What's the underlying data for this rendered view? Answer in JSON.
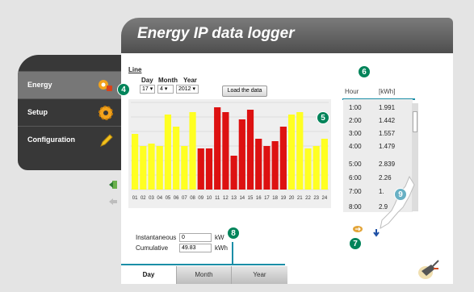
{
  "header": {
    "title": "Energy IP data logger"
  },
  "sidebar": {
    "items": [
      {
        "label": "Energy",
        "icon": "energy-icon"
      },
      {
        "label": "Setup",
        "icon": "gear-icon"
      },
      {
        "label": "Configuration",
        "icon": "pencil-icon"
      }
    ]
  },
  "controls": {
    "link": "Line",
    "day_label": "Day",
    "month_label": "Month",
    "year_label": "Year",
    "day_value": "17",
    "month_value": "4",
    "year_value": "2012",
    "load_button": "Load the data"
  },
  "chart_data": {
    "type": "bar",
    "categories": [
      "01",
      "02",
      "03",
      "04",
      "05",
      "06",
      "07",
      "08",
      "09",
      "10",
      "11",
      "12",
      "13",
      "14",
      "15",
      "16",
      "17",
      "18",
      "19",
      "20",
      "21",
      "22",
      "23",
      "24"
    ],
    "values": [
      2.3,
      1.8,
      1.9,
      1.8,
      3.1,
      2.6,
      1.8,
      3.2,
      1.7,
      1.7,
      3.4,
      3.2,
      1.4,
      2.9,
      3.3,
      2.1,
      1.8,
      2.0,
      2.6,
      3.1,
      3.2,
      1.7,
      1.8,
      2.1
    ],
    "colors": [
      "#ffff22",
      "#ffff22",
      "#ffff22",
      "#ffff22",
      "#ffff22",
      "#ffff22",
      "#ffff22",
      "#ffff22",
      "#dd1111",
      "#dd1111",
      "#dd1111",
      "#dd1111",
      "#dd1111",
      "#dd1111",
      "#dd1111",
      "#dd1111",
      "#dd1111",
      "#dd1111",
      "#dd1111",
      "#ffff22",
      "#ffff22",
      "#ffff22",
      "#ffff22",
      "#ffff22"
    ],
    "ylim": [
      0,
      3.6
    ],
    "grid": true
  },
  "table": {
    "hour_header": "Hour",
    "unit_header": "[kWh]",
    "rows": [
      {
        "hour": "1:00",
        "value": "1.991"
      },
      {
        "hour": "2:00",
        "value": "1.442"
      },
      {
        "hour": "3:00",
        "value": "1.557"
      },
      {
        "hour": "4:00",
        "value": "1.479"
      },
      {
        "hour": "5:00",
        "value": "2.839"
      },
      {
        "hour": "6:00",
        "value": "2.26"
      },
      {
        "hour": "7:00",
        "value": "1."
      },
      {
        "hour": "8:00",
        "value": "2.9"
      }
    ]
  },
  "readings": {
    "instantaneous_label": "Instantaneous",
    "instantaneous_value": "0",
    "instantaneous_unit": "kW",
    "cumulative_label": "Cumulative",
    "cumulative_value": "49.83",
    "cumulative_unit": "kWh"
  },
  "tabs": [
    "Day",
    "Month",
    "Year"
  ],
  "badges": [
    "4",
    "5",
    "6",
    "7",
    "8",
    "9"
  ],
  "colors": {
    "accent": "#00845a",
    "header": "#5e5e5e",
    "bar_low": "#ffff22",
    "bar_high": "#dd1111",
    "rule": "#1b8ea7"
  }
}
